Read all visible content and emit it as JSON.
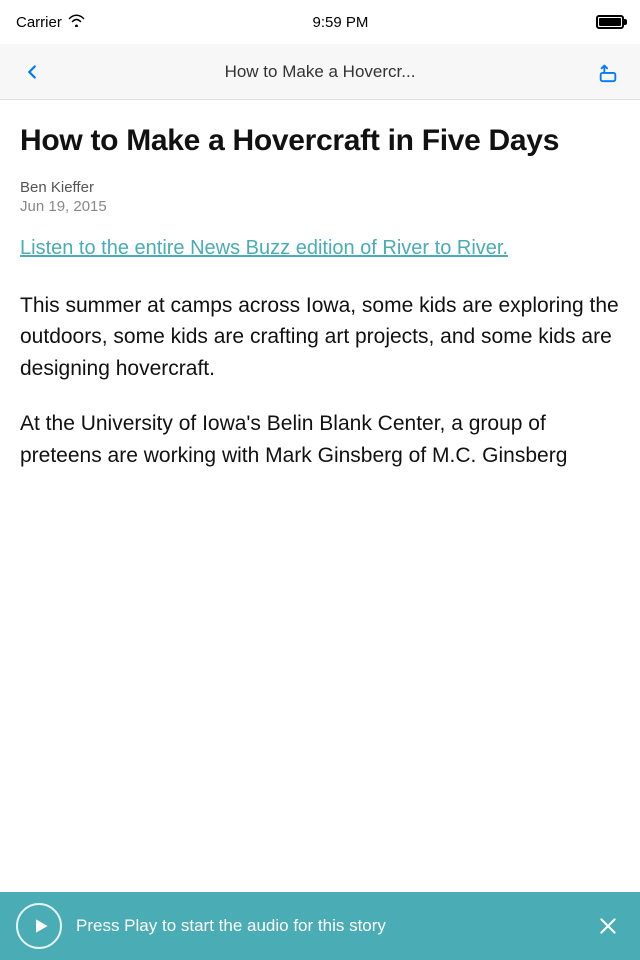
{
  "status_bar": {
    "carrier": "Carrier",
    "time": "9:59 PM"
  },
  "nav": {
    "title": "How to Make a Hovercr...",
    "back_label": "back",
    "share_label": "share"
  },
  "article": {
    "title": "How to Make a Hovercraft in Five Days",
    "author": "Ben Kieffer",
    "date": "Jun 19, 2015",
    "link_text": "Listen to the entire News Buzz edition of River to River.",
    "body_paragraph_1": "This summer at camps across Iowa, some kids are exploring the outdoors, some kids are crafting art projects, and some kids are designing hovercraft.",
    "body_paragraph_2": "At the University of Iowa's Belin Blank Center, a group of preteens are working with Mark Ginsberg of M.C. Ginsberg"
  },
  "audio_player": {
    "text": "Press Play to start the audio for this story",
    "play_label": "play",
    "close_label": "close"
  },
  "colors": {
    "link": "#4aacb4",
    "audio_bg": "#4aacb4"
  }
}
